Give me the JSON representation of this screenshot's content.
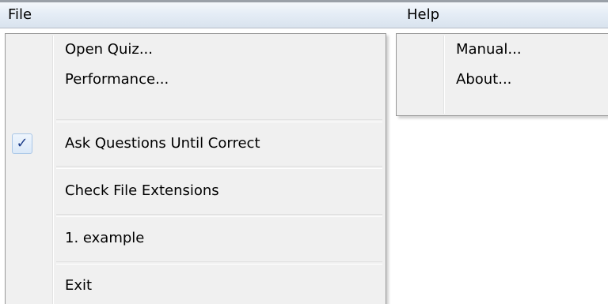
{
  "menubar": {
    "file_label": "File",
    "help_label": "Help"
  },
  "file_menu": {
    "items": [
      {
        "label": "Open Quiz..."
      },
      {
        "label": "Performance..."
      },
      {
        "label": "Ask Questions Until Correct",
        "checked": true,
        "check_glyph": "✓"
      },
      {
        "label": "Check File Extensions",
        "checked": false
      },
      {
        "label": "1. example"
      },
      {
        "label": "Exit"
      }
    ]
  },
  "help_menu": {
    "items": [
      {
        "label": "Manual..."
      },
      {
        "label": "About..."
      }
    ]
  },
  "colors": {
    "menu_background": "#f0f0f0",
    "menubar_gradient_top": "#f4f7fb",
    "menubar_gradient_bottom": "#d9e3ee",
    "check_color": "#1f3f8a"
  }
}
